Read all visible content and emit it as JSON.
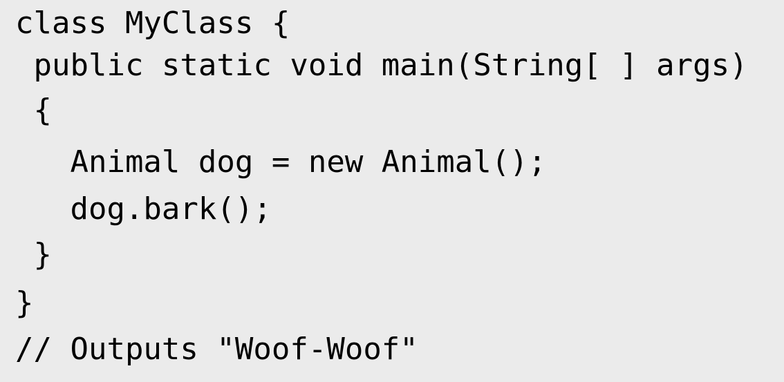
{
  "code": {
    "lines": [
      "class MyClass {",
      " public static void main(String[ ] args)",
      " {",
      "   Animal dog = new Animal();",
      "   dog.bark();",
      " }",
      "}",
      "// Outputs \"Woof-Woof\""
    ]
  },
  "colors": {
    "background": "#ebebeb",
    "text": "#000000"
  }
}
